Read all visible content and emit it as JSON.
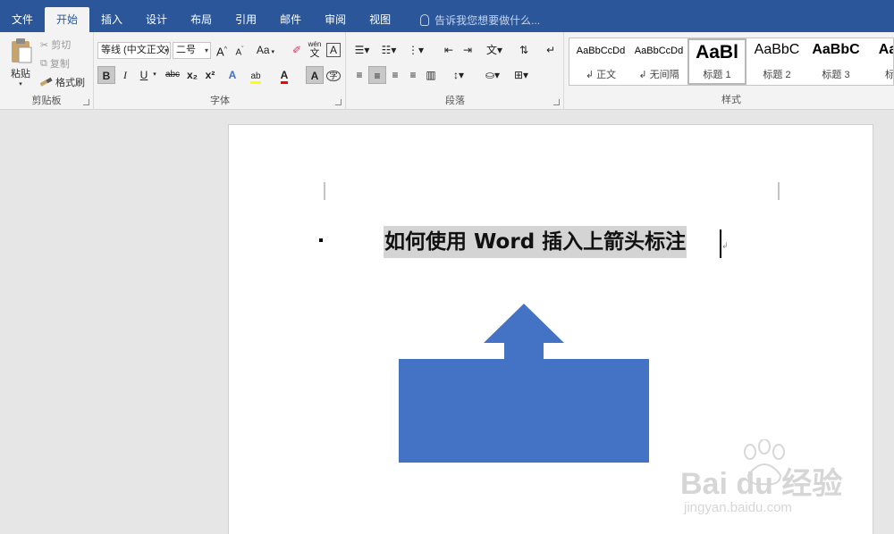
{
  "tabs": [
    "文件",
    "开始",
    "插入",
    "设计",
    "布局",
    "引用",
    "邮件",
    "审阅",
    "视图"
  ],
  "tell_me_placeholder": "告诉我您想要做什么...",
  "clipboard": {
    "label": "剪贴板",
    "paste": "粘贴",
    "cut": "剪切",
    "copy": "复制",
    "format_painter": "格式刷"
  },
  "font": {
    "label": "字体",
    "font_name": "等线 (中文正文)",
    "font_size": "二号",
    "grow": "A",
    "shrink": "A",
    "change_case": "Aa",
    "phonetic": "wén",
    "bold": "B",
    "italic": "I",
    "underline": "U",
    "strike": "abc",
    "subscript": "x₂",
    "superscript": "x²"
  },
  "paragraph": {
    "label": "段落"
  },
  "styles": {
    "label": "样式",
    "items": [
      {
        "sample": "AaBbCcDd",
        "name": "↲ 正文"
      },
      {
        "sample": "AaBbCcDd",
        "name": "↲ 无间隔"
      },
      {
        "sample": "AaBl",
        "name": "标题 1"
      },
      {
        "sample": "AaBbC",
        "name": "标题 2"
      },
      {
        "sample": "AaBbC",
        "name": "标题 3"
      },
      {
        "sample": "AaBl",
        "name": "标题"
      }
    ]
  },
  "document": {
    "heading": "如何使用 Word 插入上箭头标注",
    "shape_color": "#4472c4"
  },
  "watermark": {
    "brand": "Bai du 经验",
    "url": "jingyan.baidu.com"
  },
  "colors": {
    "accent": "#2b579a",
    "highlight": "#ffff00",
    "font_color": "#ff0000"
  }
}
